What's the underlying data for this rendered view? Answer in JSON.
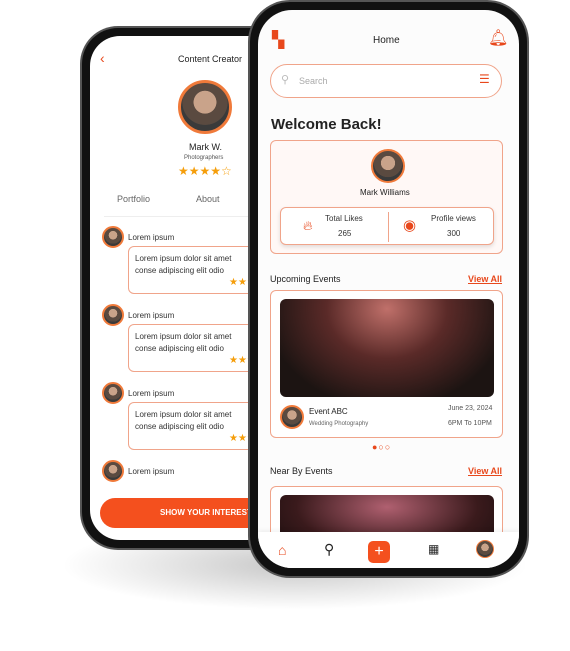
{
  "back": {
    "title": "Content Creator",
    "name": "Mark W.",
    "role": "Photographers",
    "rating": 4,
    "rating_max": 5,
    "tabs": [
      "Portfolio",
      "About"
    ],
    "reviews": [
      {
        "user": "Lorem ipsum",
        "text": "Lorem ipsum dolor sit amet conse adipiscing elit odio"
      },
      {
        "user": "Lorem ipsum",
        "text": "Lorem ipsum dolor sit amet conse adipiscing elit odio"
      },
      {
        "user": "Lorem ipsum",
        "text": "Lorem ipsum dolor sit amet conse adipiscing elit odio"
      },
      {
        "user": "Lorem ipsum",
        "text": ""
      }
    ],
    "cta": "SHOW YOUR INTEREST"
  },
  "front": {
    "title": "Home",
    "search_placeholder": "Search",
    "welcome": "Welcome Back!",
    "user": "Mark Williams",
    "stats": [
      {
        "label": "Total Likes",
        "value": "265",
        "icon": "fire-icon"
      },
      {
        "label": "Profile views",
        "value": "300",
        "icon": "eye-icon"
      }
    ],
    "upcoming": {
      "title": "Upcoming Events",
      "view_all": "View All"
    },
    "event": {
      "name": "Event ABC",
      "type": "Wedding Photography",
      "date": "June 23, 2024",
      "time": "6PM To 10PM"
    },
    "nearby": {
      "title": "Near By Events",
      "view_all": "View All"
    },
    "nav": [
      "home-icon",
      "search-icon",
      "add-icon",
      "calendar-icon",
      "profile-avatar"
    ]
  },
  "colors": {
    "accent": "#e8481c"
  }
}
